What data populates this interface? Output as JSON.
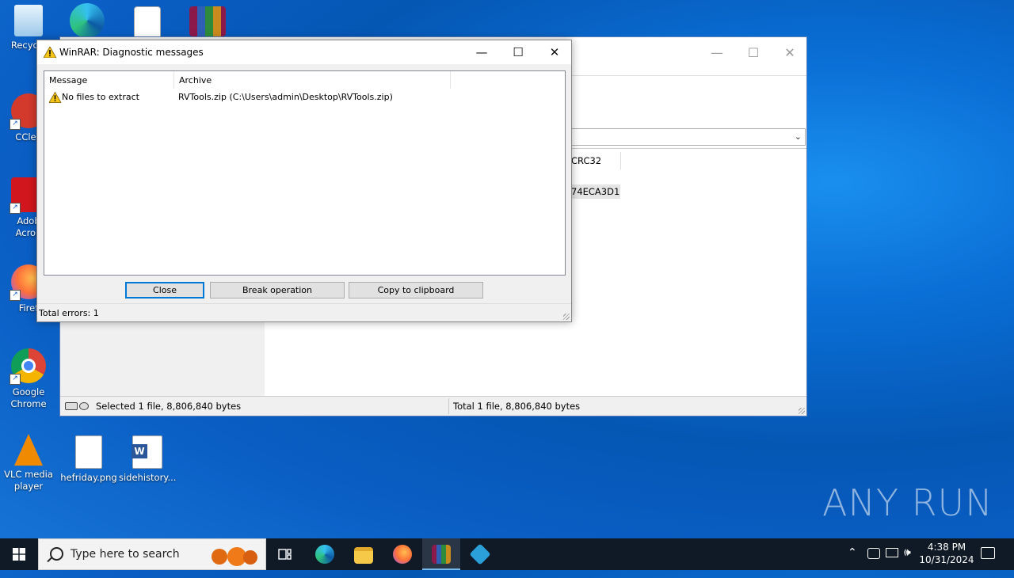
{
  "desktop": {
    "icons": [
      {
        "label": "Recycle",
        "color": "#cfe6f7"
      },
      {
        "label": "CClea",
        "color": "#d33a2c"
      },
      {
        "label": "Adob Acrob",
        "color": "#d2161e"
      },
      {
        "label": "Firef",
        "color": "#ff7139"
      },
      {
        "label": "Google Chrome",
        "color": "#4285f4"
      },
      {
        "label": "VLC media player",
        "color": "#f08a00"
      },
      {
        "label": "hefriday.png",
        "color": "#ffffff"
      },
      {
        "label": "sidehistory...",
        "color": "#2b579a"
      }
    ]
  },
  "main_window": {
    "caption_buttons": {
      "minimize": "—",
      "maximize": "☐",
      "close": "✕"
    },
    "column_header": "CRC32",
    "row_crc": "74ECA3D1",
    "status_left": "Selected 1 file, 8,806,840 bytes",
    "status_right": "Total 1 file, 8,806,840 bytes"
  },
  "dialog": {
    "title": "WinRAR: Diagnostic messages",
    "caption_buttons": {
      "minimize": "—",
      "maximize": "☐",
      "close": "✕"
    },
    "columns": [
      "Message",
      "Archive"
    ],
    "rows": [
      {
        "message": "No files to extract",
        "archive": "RVTools.zip (C:\\Users\\admin\\Desktop\\RVTools.zip)"
      }
    ],
    "buttons": {
      "close": "Close",
      "break": "Break operation",
      "copy": "Copy to clipboard"
    },
    "status": "Total errors: 1"
  },
  "watermark": "ANY RUN",
  "taskbar": {
    "search_placeholder": "Type here to search",
    "time": "4:38 PM",
    "date": "10/31/2024"
  }
}
